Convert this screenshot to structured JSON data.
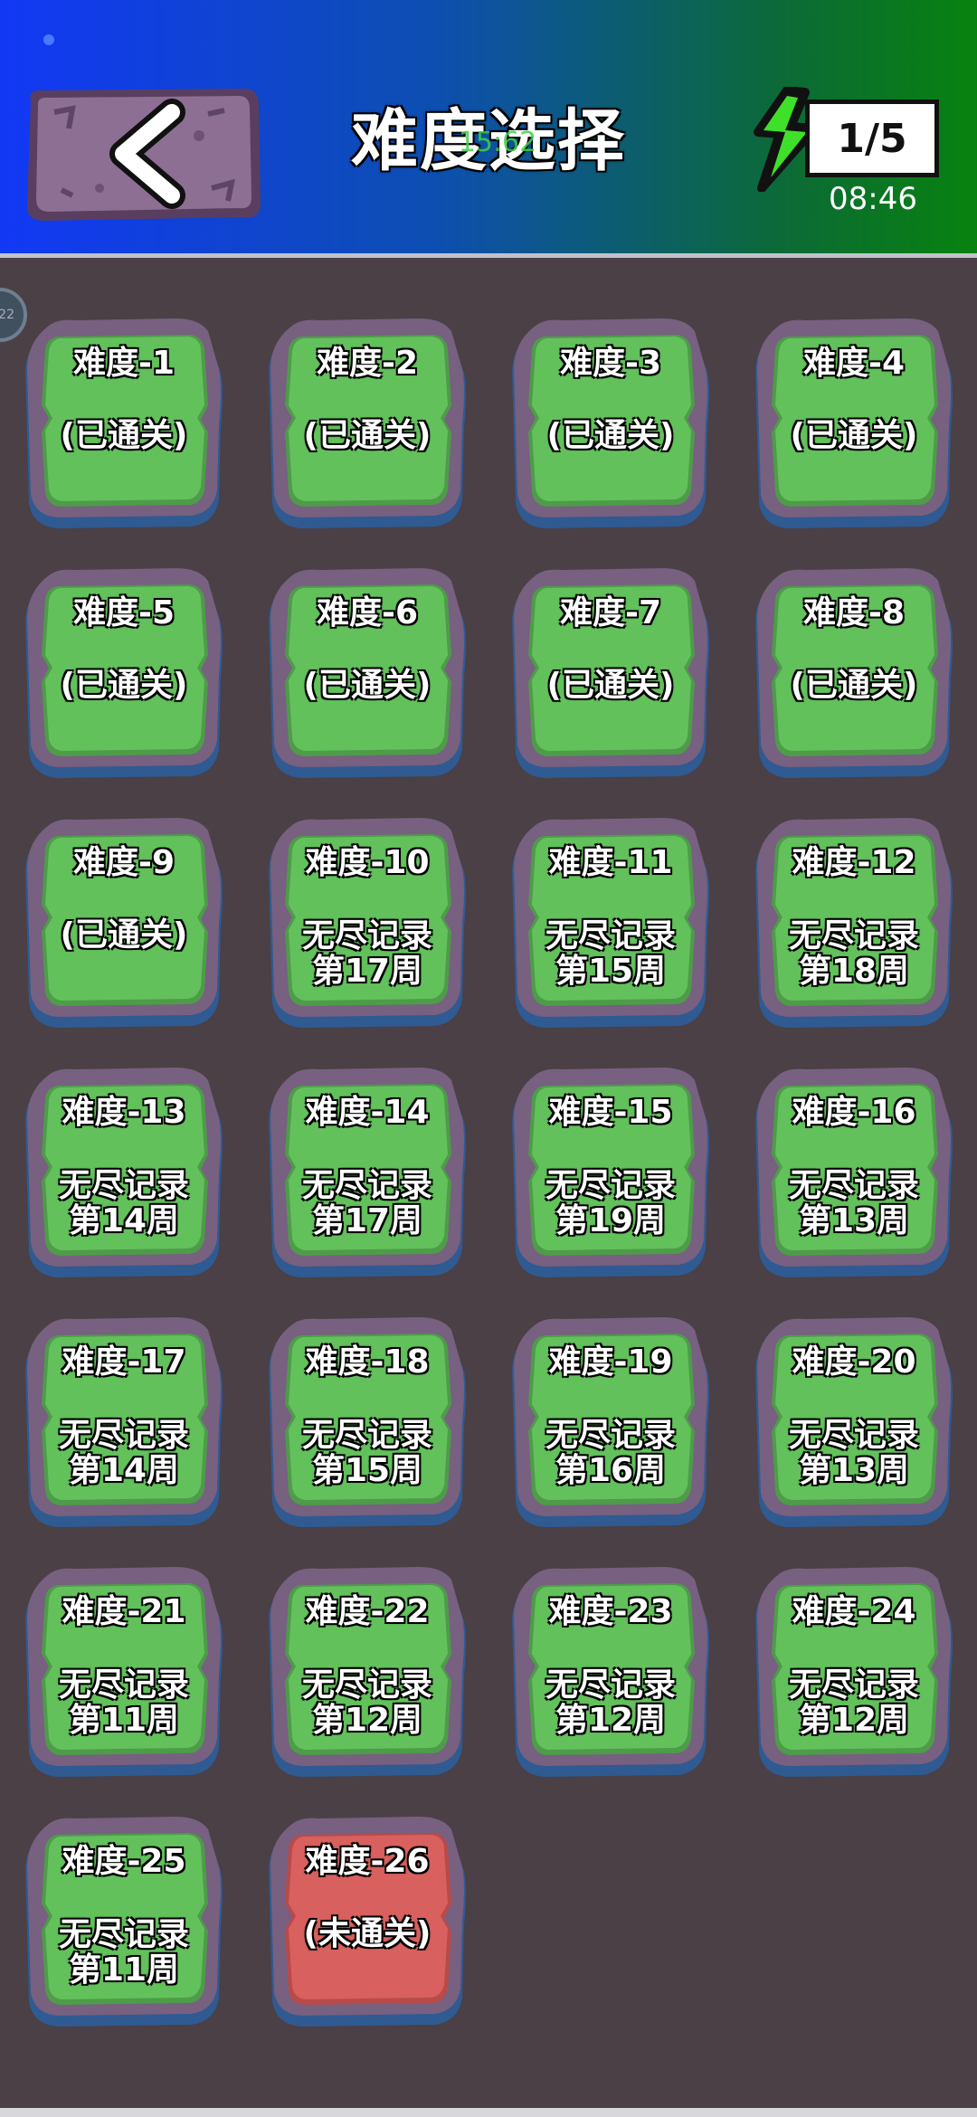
{
  "header": {
    "title": "难度选择",
    "title_overlay": "15:62",
    "energy_value": "1/5",
    "energy_timer": "08:46",
    "side_badge": "22"
  },
  "colors": {
    "header_gradient": [
      "#1238f5",
      "#08820f"
    ],
    "background": "#4a4045",
    "tile_green": "#63c15c",
    "tile_red": "#d8605e",
    "frame_purple": "#776080",
    "frame_blue": "#2f5a92"
  },
  "icons": {
    "back": "chevron-left-icon",
    "energy": "lightning-bolt-icon"
  },
  "levels": [
    {
      "name": "难度-1",
      "line1": "(已通关)",
      "line2": "",
      "state": "cleared"
    },
    {
      "name": "难度-2",
      "line1": "(已通关)",
      "line2": "",
      "state": "cleared"
    },
    {
      "name": "难度-3",
      "line1": "(已通关)",
      "line2": "",
      "state": "cleared"
    },
    {
      "name": "难度-4",
      "line1": "(已通关)",
      "line2": "",
      "state": "cleared"
    },
    {
      "name": "难度-5",
      "line1": "(已通关)",
      "line2": "",
      "state": "cleared"
    },
    {
      "name": "难度-6",
      "line1": "(已通关)",
      "line2": "",
      "state": "cleared"
    },
    {
      "name": "难度-7",
      "line1": "(已通关)",
      "line2": "",
      "state": "cleared"
    },
    {
      "name": "难度-8",
      "line1": "(已通关)",
      "line2": "",
      "state": "cleared"
    },
    {
      "name": "难度-9",
      "line1": "(已通关)",
      "line2": "",
      "state": "cleared"
    },
    {
      "name": "难度-10",
      "line1": "无尽记录",
      "line2": "第17周",
      "state": "endless"
    },
    {
      "name": "难度-11",
      "line1": "无尽记录",
      "line2": "第15周",
      "state": "endless"
    },
    {
      "name": "难度-12",
      "line1": "无尽记录",
      "line2": "第18周",
      "state": "endless"
    },
    {
      "name": "难度-13",
      "line1": "无尽记录",
      "line2": "第14周",
      "state": "endless"
    },
    {
      "name": "难度-14",
      "line1": "无尽记录",
      "line2": "第17周",
      "state": "endless"
    },
    {
      "name": "难度-15",
      "line1": "无尽记录",
      "line2": "第19周",
      "state": "endless"
    },
    {
      "name": "难度-16",
      "line1": "无尽记录",
      "line2": "第13周",
      "state": "endless"
    },
    {
      "name": "难度-17",
      "line1": "无尽记录",
      "line2": "第14周",
      "state": "endless"
    },
    {
      "name": "难度-18",
      "line1": "无尽记录",
      "line2": "第15周",
      "state": "endless"
    },
    {
      "name": "难度-19",
      "line1": "无尽记录",
      "line2": "第16周",
      "state": "endless"
    },
    {
      "name": "难度-20",
      "line1": "无尽记录",
      "line2": "第13周",
      "state": "endless"
    },
    {
      "name": "难度-21",
      "line1": "无尽记录",
      "line2": "第11周",
      "state": "endless"
    },
    {
      "name": "难度-22",
      "line1": "无尽记录",
      "line2": "第12周",
      "state": "endless"
    },
    {
      "name": "难度-23",
      "line1": "无尽记录",
      "line2": "第12周",
      "state": "endless"
    },
    {
      "name": "难度-24",
      "line1": "无尽记录",
      "line2": "第12周",
      "state": "endless"
    },
    {
      "name": "难度-25",
      "line1": "无尽记录",
      "line2": "第11周",
      "state": "endless"
    },
    {
      "name": "难度-26",
      "line1": "(未通关)",
      "line2": "",
      "state": "locked"
    }
  ]
}
